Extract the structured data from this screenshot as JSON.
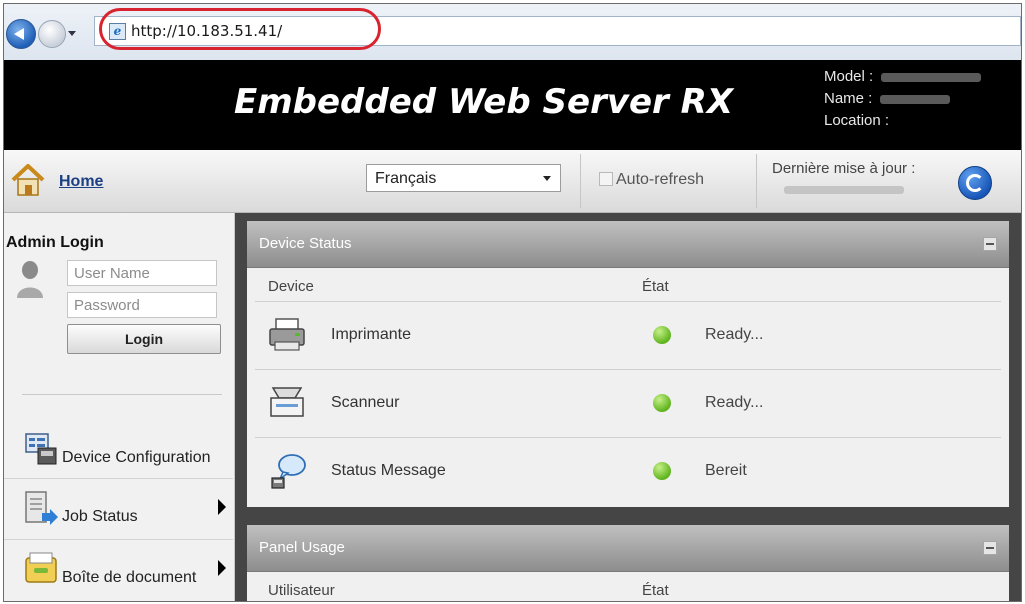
{
  "browser": {
    "url": "http://10.183.51.41/"
  },
  "header": {
    "title": "Embedded Web Server RX",
    "model_label": "Model :",
    "name_label": "Name :",
    "location_label": "Location :"
  },
  "toolbar": {
    "home_label": "Home",
    "language_selected": "Français",
    "auto_refresh_label": "Auto-refresh",
    "auto_refresh_checked": false,
    "last_update_label": "Dernière mise à jour :"
  },
  "sidebar": {
    "admin_title": "Admin Login",
    "username_placeholder": "User Name",
    "password_placeholder": "Password",
    "login_button": "Login",
    "items": [
      {
        "label": "Device Configuration",
        "icon": "device-config-icon",
        "has_submenu": false
      },
      {
        "label": "Job Status",
        "icon": "job-status-icon",
        "has_submenu": true
      },
      {
        "label": "Boîte de document",
        "icon": "document-box-icon",
        "has_submenu": true
      }
    ]
  },
  "device_status": {
    "title": "Device Status",
    "col_device": "Device",
    "col_state": "État",
    "rows": [
      {
        "name": "Imprimante",
        "state": "Ready...",
        "icon": "printer-icon",
        "status_color": "#6cbf2a"
      },
      {
        "name": "Scanneur",
        "state": "Ready...",
        "icon": "scanner-icon",
        "status_color": "#6cbf2a"
      },
      {
        "name": "Status Message",
        "state": "Bereit",
        "icon": "message-icon",
        "status_color": "#6cbf2a"
      }
    ]
  },
  "panel_usage": {
    "title": "Panel Usage",
    "col_user": "Utilisateur",
    "col_state": "État"
  },
  "colors": {
    "header_bg": "#000000",
    "link": "#1b3f84",
    "status_ok": "#6cbf2a",
    "highlight": "#d8242f"
  }
}
